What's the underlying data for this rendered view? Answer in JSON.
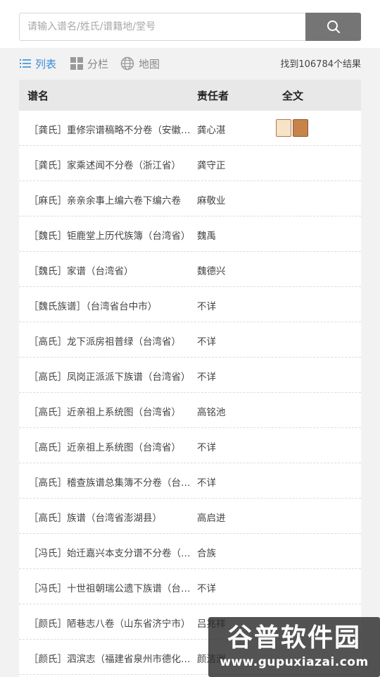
{
  "search": {
    "placeholder": "请输入谱名/姓氏/谱籍地/堂号",
    "value": ""
  },
  "toolbar": {
    "views": [
      {
        "label": "列表",
        "icon": "list-icon",
        "active": true
      },
      {
        "label": "分栏",
        "icon": "grid-icon",
        "active": false
      },
      {
        "label": "地图",
        "icon": "globe-icon",
        "active": false
      }
    ],
    "result_count": "找到106784个结果"
  },
  "table": {
    "headers": {
      "name": "谱名",
      "responsible": "责任者",
      "fulltext": "全文"
    },
    "rows": [
      {
        "name": "［龚氏］重修宗谱稿略不分卷（安徽省）",
        "responsible": "龚心湛",
        "has_fulltext": true
      },
      {
        "name": "［龚氏］家乘述闻不分卷（浙江省）",
        "responsible": "龚守正",
        "has_fulltext": false
      },
      {
        "name": "［麻氏］亲亲余事上编六卷下编六卷",
        "responsible": "麻敬业",
        "has_fulltext": false
      },
      {
        "name": "［魏氏］钜鹿堂上历代族簿（台湾省）",
        "responsible": "魏禹",
        "has_fulltext": false
      },
      {
        "name": "［魏氏］家谱（台湾省）",
        "responsible": "魏德兴",
        "has_fulltext": false
      },
      {
        "name": "［魏氏族谱］（台湾省台中市）",
        "responsible": "不详",
        "has_fulltext": false
      },
      {
        "name": "［高氏］龙下派房祖普绿（台湾省）",
        "responsible": "不详",
        "has_fulltext": false
      },
      {
        "name": "［高氏］凤岗正派派下族谱（台湾省）",
        "responsible": "不详",
        "has_fulltext": false
      },
      {
        "name": "［高氏］近亲祖上系统图（台湾省）",
        "responsible": "高铭池",
        "has_fulltext": false
      },
      {
        "name": "［高氏］近亲祖上系统图（台湾省）",
        "responsible": "不详",
        "has_fulltext": false
      },
      {
        "name": "［高氏］稽查族谱总集簿不分卷（台湾省）",
        "responsible": "不详",
        "has_fulltext": false
      },
      {
        "name": "［高氏］族谱（台湾省澎湖县）",
        "responsible": "高启进",
        "has_fulltext": false
      },
      {
        "name": "［冯氏］始迁嘉兴本支分谱不分卷（浙江省）",
        "responsible": "合族",
        "has_fulltext": false
      },
      {
        "name": "［冯氏］十世祖朝瑞公遗下族谱（台湾省）",
        "responsible": "不详",
        "has_fulltext": false
      },
      {
        "name": "［颜氏］陋巷志八卷（山东省济宁市）",
        "responsible": "吕兆祥",
        "has_fulltext": false
      },
      {
        "name": "［颜氏］泗滨志（福建省泉州市德化县）",
        "responsible": "颜洁洲",
        "has_fulltext": false
      }
    ]
  },
  "watermark": {
    "title": "谷普软件园",
    "url": "www.gupuxiazai.com"
  }
}
